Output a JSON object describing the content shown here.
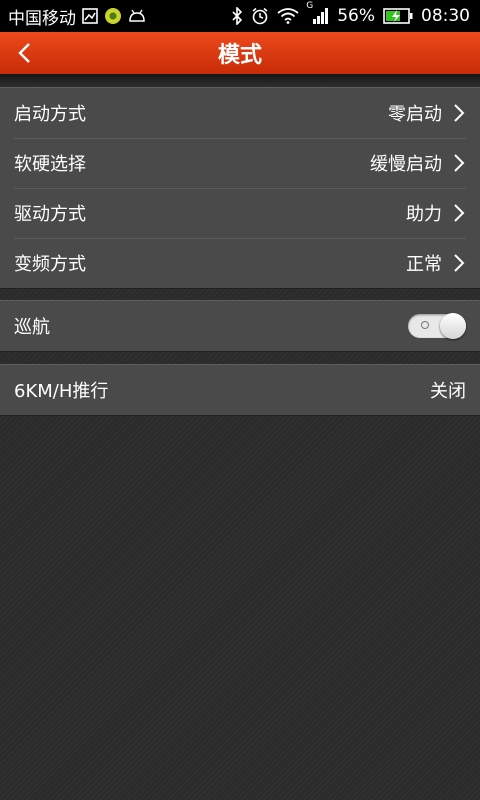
{
  "status_bar": {
    "carrier": "中国移动",
    "signal_type": "G",
    "battery": "56%",
    "time": "08:30",
    "icons": [
      "image-icon",
      "app-badge-icon",
      "android-icon",
      "bluetooth-icon",
      "alarm-icon",
      "wifi-icon",
      "signal-icon",
      "battery-icon"
    ]
  },
  "header": {
    "title": "模式",
    "back_icon": "chevron-left-icon",
    "color": "#e0401a"
  },
  "settings": {
    "group1": [
      {
        "label": "启动方式",
        "value": "零启动"
      },
      {
        "label": "软硬选择",
        "value": "缓慢启动"
      },
      {
        "label": "驱动方式",
        "value": "助力"
      },
      {
        "label": "变频方式",
        "value": "正常"
      }
    ],
    "cruise": {
      "label": "巡航",
      "toggle_on": false
    },
    "push": {
      "label": "6KM/H推行",
      "value": "关闭"
    }
  }
}
